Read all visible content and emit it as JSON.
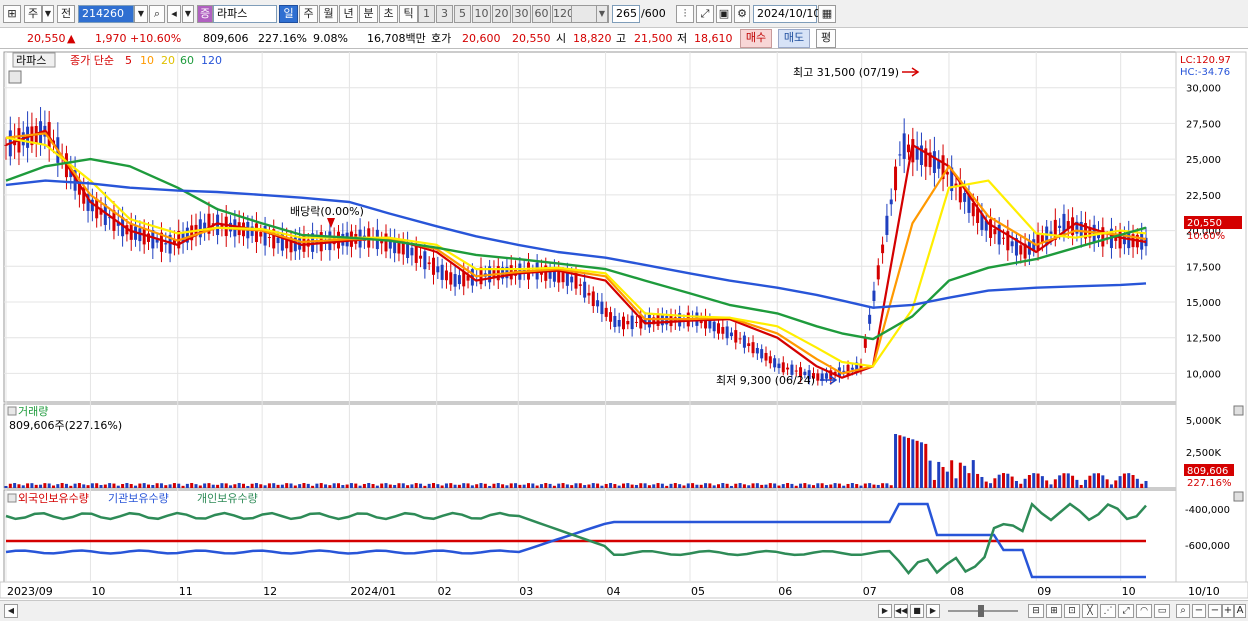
{
  "toolbar": {
    "market_label": "주",
    "prev_label": "전",
    "code": "214260",
    "stock_badge": "증",
    "stock_name": "라파스",
    "periods": [
      "일",
      "주",
      "월",
      "년",
      "분",
      "초",
      "틱"
    ],
    "selected_period": "일",
    "minutes": [
      "1",
      "3",
      "5",
      "10",
      "20",
      "30",
      "60",
      "120"
    ],
    "count": "265",
    "count_max": "/600",
    "date": "2024/10/10"
  },
  "quote": {
    "price": "20,550",
    "up_mark": "▲",
    "change": "1,970",
    "change_pct": "+10.60%",
    "volume": "809,606",
    "volume_ratio": "227.16%",
    "turnover": "9.08%",
    "amount": "16,708백만",
    "bid_label": "호가",
    "ask": "20,600",
    "bid": "20,550",
    "open_label": "시",
    "open": "18,820",
    "high_label": "고",
    "high": "21,500",
    "low_label": "저",
    "low": "18,610",
    "buy_button": "매수",
    "sell_button": "매도",
    "eval_button": "평"
  },
  "price_panel": {
    "stock_tag": "라파스",
    "ma_title": "종가 단순",
    "ma_periods": [
      "5",
      "10",
      "20",
      "60",
      "120"
    ],
    "ma_colors": [
      "#d40000",
      "#ff9900",
      "#ffee00",
      "#1e9b3c",
      "#2855d8"
    ],
    "lc": "LC:120.97",
    "hc": "HC:-34.76",
    "max_note": "최고 31,500 (07/19)",
    "min_note": "최저 9,300 (06/24)",
    "dividend_note": "배당락(0.00%)",
    "last_price_tag": "20,550",
    "last_pct_tag": "10.60%"
  },
  "volume_panel": {
    "title": "거래량",
    "info": "809,606주(227.16%)",
    "last_tag": "809,606",
    "last_pct": "227.16%"
  },
  "holding_panel": {
    "legend": [
      "외국인보유수량",
      "기관보유수량",
      "개인보유수량"
    ],
    "colors": [
      "#d40000",
      "#2855d8",
      "#2e8b57"
    ]
  },
  "x_axis": [
    "2023/09",
    "10",
    "11",
    "12",
    "2024/01",
    "02",
    "03",
    "04",
    "05",
    "06",
    "07",
    "08",
    "09",
    "10"
  ],
  "x_axis_right": "10/10",
  "chart_data": [
    {
      "type": "line",
      "title": "",
      "y_ticks": [
        10000,
        12500,
        15000,
        17500,
        20000,
        22500,
        25000,
        27500,
        30000
      ],
      "y_tick_labels": [
        "10,000",
        "12,500",
        "15,000",
        "17,500",
        "20,000",
        "22,500",
        "25,000",
        "27,500",
        "30,000"
      ],
      "ylim": [
        8000,
        32500
      ],
      "x": [
        "2023/09/01",
        "2023/09/15",
        "2023/10/01",
        "2023/10/15",
        "2023/11/01",
        "2023/11/15",
        "2023/12/01",
        "2023/12/15",
        "2024/01/01",
        "2024/01/15",
        "2024/02/01",
        "2024/02/15",
        "2024/03/01",
        "2024/03/15",
        "2024/04/01",
        "2024/04/15",
        "2024/05/01",
        "2024/05/15",
        "2024/06/01",
        "2024/06/15",
        "2024/06/24",
        "2024/07/05",
        "2024/07/19",
        "2024/08/01",
        "2024/08/15",
        "2024/09/01",
        "2024/09/15",
        "2024/10/01",
        "2024/10/10"
      ],
      "series": [
        {
          "name": "5",
          "values": [
            26000,
            27000,
            22000,
            20000,
            19000,
            20500,
            20000,
            19000,
            19300,
            19500,
            18500,
            16500,
            17000,
            17200,
            16500,
            13500,
            13700,
            13800,
            12500,
            10500,
            9700,
            10500,
            26000,
            24500,
            20500,
            18500,
            20500,
            19500,
            19200
          ]
        },
        {
          "name": "10",
          "values": [
            26500,
            26800,
            22500,
            20500,
            19300,
            20200,
            20000,
            19200,
            19400,
            19400,
            18700,
            16800,
            17100,
            17300,
            16800,
            13800,
            13800,
            13900,
            12800,
            11000,
            10000,
            10500,
            20500,
            24500,
            21000,
            19000,
            20000,
            19700,
            19400
          ]
        },
        {
          "name": "20",
          "values": [
            26500,
            26000,
            23500,
            20800,
            19800,
            20200,
            20100,
            19500,
            19500,
            19500,
            19000,
            17300,
            17300,
            17400,
            17000,
            14200,
            14000,
            13900,
            13300,
            11800,
            10800,
            10500,
            14500,
            23000,
            23500,
            19800,
            19500,
            20000,
            19800
          ]
        },
        {
          "name": "60",
          "values": [
            23500,
            24500,
            25000,
            24500,
            23000,
            21500,
            20500,
            19700,
            19500,
            19300,
            18800,
            18300,
            18000,
            17700,
            17300,
            16500,
            15600,
            14800,
            14200,
            13300,
            12800,
            12400,
            14000,
            16500,
            17400,
            18000,
            18800,
            19700,
            20200
          ]
        },
        {
          "name": "120",
          "values": [
            23200,
            23500,
            23300,
            23000,
            22800,
            22700,
            22500,
            22300,
            22000,
            21200,
            20300,
            19600,
            19000,
            18500,
            18100,
            17600,
            17000,
            16500,
            16000,
            15500,
            15100,
            14600,
            14800,
            15300,
            15800,
            16000,
            16100,
            16200,
            16300
          ]
        }
      ]
    }
  ]
}
